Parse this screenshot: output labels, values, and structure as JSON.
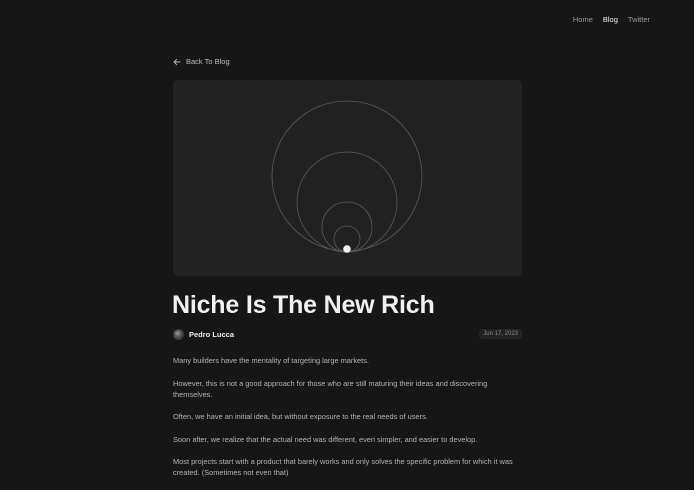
{
  "nav": {
    "items": [
      {
        "label": "Home",
        "active": false
      },
      {
        "label": "Blog",
        "active": true
      },
      {
        "label": "Twitter",
        "active": false
      }
    ]
  },
  "back": {
    "label": "Back To Blog",
    "icon": "arrow-left-icon"
  },
  "post": {
    "title": "Niche Is The New Rich",
    "author": "Pedro Lucca",
    "date": "Jun 17, 2023",
    "paragraphs": [
      "Many builders have the mentality of targeting large markets.",
      "However, this is not a good approach for those who are still maturing their ideas and discovering themselves.",
      "Often, we have an initial idea, but without exposure to the real needs of users.",
      "Soon after, we realize that the actual need was different, even simpler, and easier to develop.",
      "Most projects start with a product that barely works and only solves the specific problem for which it was created. (Sometimes not even that)"
    ]
  },
  "colors": {
    "background": "#161616",
    "hero_background": "#222222",
    "circle_stroke": "#5a5a5a",
    "dot": "#f0f0f0"
  }
}
